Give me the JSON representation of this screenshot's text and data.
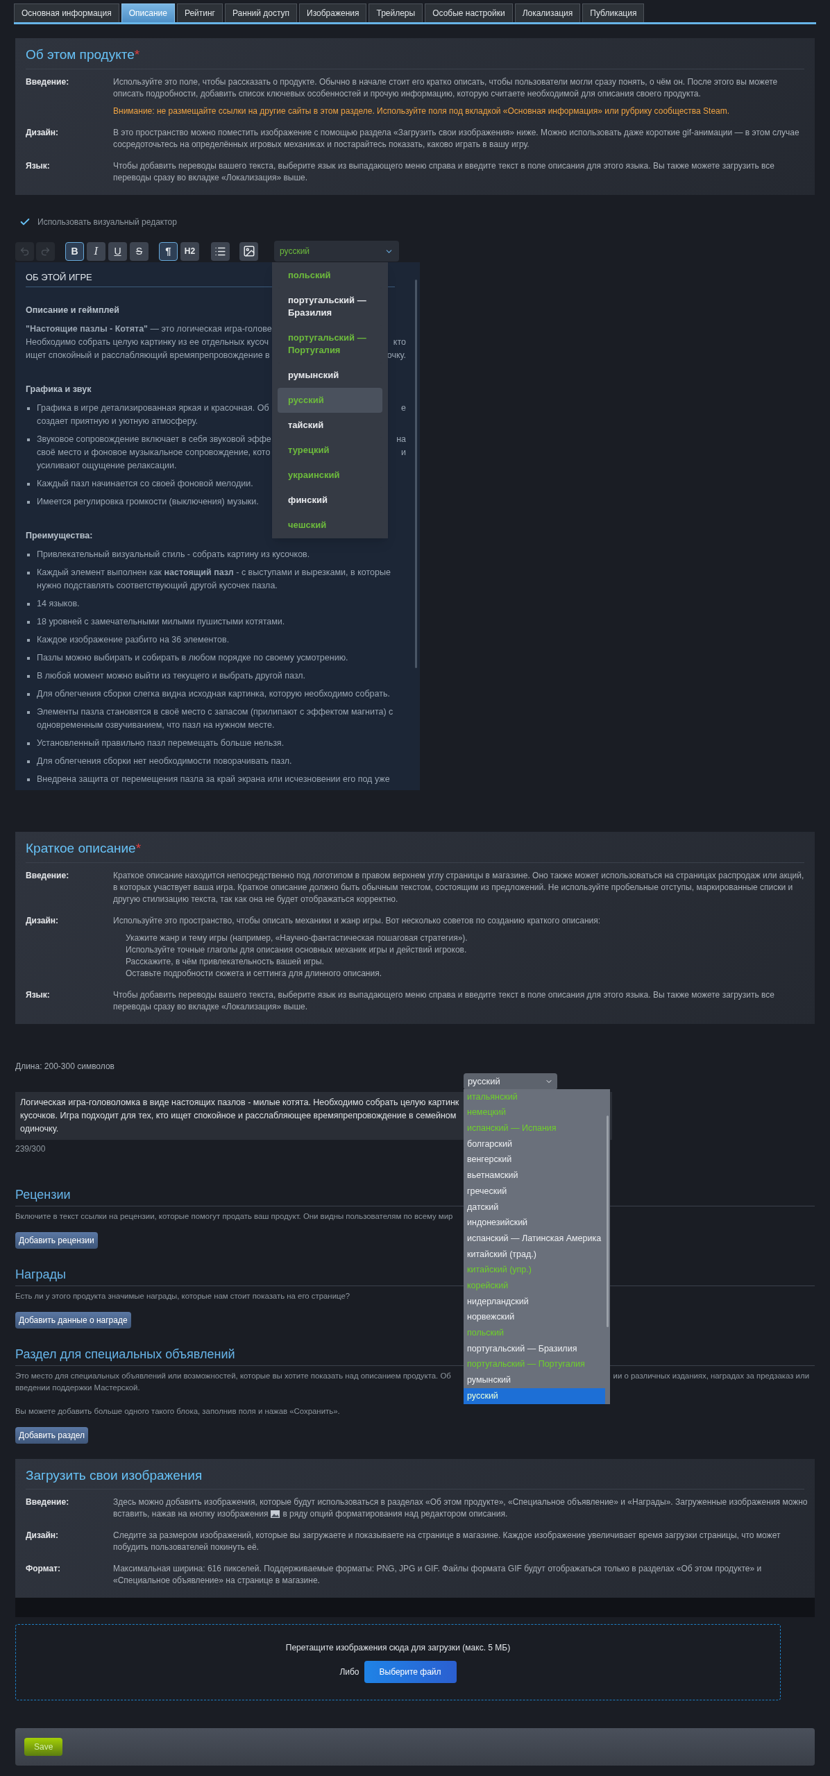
{
  "tabs": [
    {
      "label": "Основная информация",
      "selected": false
    },
    {
      "label": "Описание",
      "selected": true
    },
    {
      "label": "Рейтинг",
      "selected": false
    },
    {
      "label": "Ранний доступ",
      "selected": false
    },
    {
      "label": "Изображения",
      "selected": false
    },
    {
      "label": "Трейлеры",
      "selected": false
    },
    {
      "label": "Особые настройки",
      "selected": false
    },
    {
      "label": "Локализация",
      "selected": false
    },
    {
      "label": "Публикация",
      "selected": false
    }
  ],
  "about": {
    "title": "Об этом продукте",
    "required_mark": "*",
    "rows": [
      {
        "label": "Введение:",
        "text": "Используйте это поле, чтобы рассказать о продукте. Обычно в начале стоит его кратко описать, чтобы пользователи могли сразу понять, о чём он. После этого вы можете описать подробности, добавить список ключевых особенностей и прочую информацию, которую считаете необходимой для описания своего продукта.",
        "warning": "Внимание: не размещайте ссылки на другие сайты в этом разделе. Используйте поля под вкладкой «Основная информация» или рубрику сообщества Steam."
      },
      {
        "label": "Дизайн:",
        "text": "В это пространство можно поместить изображение с помощью раздела «Загрузить свои изображения» ниже. Можно использовать даже короткие gif-анимации — в этом случае сосредоточьтесь на определённых игровых механиках и постарайтесь показать, каково играть в вашу игру."
      },
      {
        "label": "Язык:",
        "text": "Чтобы добавить переводы вашего текста, выберите язык из выпадающего меню справа и введите текст в поле описания для этого языка. Вы также можете загрузить все переводы сразу во вкладке «Локализация» выше."
      }
    ]
  },
  "visual_editor": {
    "label": "Использовать визуальный редактор",
    "checked": true
  },
  "toolbar": {
    "history": [
      {
        "kind": "undo",
        "disabled": true
      },
      {
        "kind": "redo",
        "disabled": true
      }
    ],
    "format": [
      {
        "kind": "bold",
        "label": "B",
        "active": true
      },
      {
        "kind": "italic",
        "label": "I",
        "active": false
      },
      {
        "kind": "underline",
        "label": "U",
        "active": false
      },
      {
        "kind": "strike",
        "label": "S",
        "active": false
      }
    ],
    "block": [
      {
        "kind": "paragraph",
        "label": "¶",
        "active": true
      },
      {
        "kind": "heading",
        "label": "H2",
        "active": false
      }
    ]
  },
  "language_select": {
    "value": "русский",
    "translated": true,
    "options": [
      {
        "label": "польский",
        "translated": true,
        "selected": false
      },
      {
        "label": "португальский — Бразилия",
        "translated": false,
        "selected": false
      },
      {
        "label": "португальский — Португалия",
        "translated": true,
        "selected": false
      },
      {
        "label": "румынский",
        "translated": false,
        "selected": false
      },
      {
        "label": "русский",
        "translated": true,
        "selected": true
      },
      {
        "label": "тайский",
        "translated": false,
        "selected": false
      },
      {
        "label": "турецкий",
        "translated": true,
        "selected": false
      },
      {
        "label": "украинский",
        "translated": true,
        "selected": false
      },
      {
        "label": "финский",
        "translated": false,
        "selected": false
      },
      {
        "label": "чешский",
        "translated": true,
        "selected": false
      }
    ]
  },
  "editor": {
    "heading": "ОБ ЭТОЙ ИГРЕ",
    "blocks": [
      {
        "kind": "subheading",
        "text": "Описание и геймплей"
      },
      {
        "kind": "paragraph",
        "lines": [
          {
            "left": "**\"Настоящие пазлы - Котята\"** — это логическая игра-голове"
          },
          {
            "left": "Необходимо собрать целую картинку из ее отдельных кусоч",
            "right": "кто"
          },
          {
            "left": "ищет спокойный и расслабляющий времяпрепровождение в",
            "right": "очку."
          }
        ]
      },
      {
        "kind": "subheading",
        "text": "Графика и звук"
      },
      {
        "kind": "bullets",
        "items": [
          {
            "lines": [
              {
                "left": "Графика в игре детализированная яркая и красочная. Об",
                "right": "е"
              },
              {
                "left": "создает приятную и уютную атмосферу."
              }
            ]
          },
          {
            "lines": [
              {
                "left": "Звуковое сопровождение включает в себя звуковой эффе",
                "right": "на"
              },
              {
                "left": "своё место и фоновое музыкальное сопровождение, кото",
                "right": "и"
              },
              {
                "left": "усиливают ощущение релаксации."
              }
            ]
          },
          {
            "text": "Каждый пазл начинается со своей фоновой мелодии."
          },
          {
            "text": "Имеется регулировка громкости (выключения) музыки."
          }
        ]
      },
      {
        "kind": "subheading",
        "text": "Преимущества:"
      },
      {
        "kind": "bullets",
        "items": [
          {
            "text": "Привлекательный визуальный стиль - собрать картину из кусочков."
          },
          {
            "text": "Каждый элемент выполнен как **настоящий пазл** - с выступами и вырезками, в которые нужно подставлять соответствующий другой кусочек пазла."
          },
          {
            "text": "14 языков."
          },
          {
            "text": "18 уровней с замечательными милыми пушистыми котятами."
          },
          {
            "text": "Каждое изображение разбито на 36 элементов."
          },
          {
            "text": "Пазлы можно выбирать и собирать в любом порядке по своему усмотрению."
          },
          {
            "text": "В любой момент можно выйти из текущего и выбрать другой пазл."
          },
          {
            "text": "Для облегчения сборки слегка видна исходная картинка, которую необходимо собрать."
          },
          {
            "text": "Элементы пазла становятся в своё место с запасом (прилипают с эффектом магнита) с одновременным озвучиванием, что пазл на нужном месте."
          },
          {
            "text": "Установленный правильно пазл перемещать больше нельзя."
          },
          {
            "text": "Для облегчения сборки нет необходимости поворачивать пазл."
          },
          {
            "lines": [
              {
                "left": "Внедрена защита от перемещения пазла за край экрана или исчезновении его под уже"
              }
            ]
          }
        ]
      }
    ]
  },
  "short_description": {
    "title": "Краткое описание",
    "required_mark": "*",
    "rows": [
      {
        "label": "Введение:",
        "text": "Краткое описание находится непосредственно под логотипом в правом верхнем углу страницы в магазине. Оно также может использоваться на страницах распродаж или акций, в которых участвует ваша игра. Краткое описание должно быть обычным текстом, состоящим из предложений. Не используйте пробельные отступы, маркированные списки и другую стилизацию текста, так как она не будет отображаться корректно."
      },
      {
        "label": "Дизайн:",
        "text": "Используйте это пространство, чтобы описать механики и жанр игры. Вот несколько советов по созданию краткого описания:",
        "tips": [
          "Укажите жанр и тему игры (например, «Научно-фантастическая пошаговая стратегия»).",
          "Используйте точные глаголы для описания основных механик игры и действий игроков.",
          "Расскажите, в чём привлекательность вашей игры.",
          "Оставьте подробности сюжета и сеттинга для длинного описания."
        ]
      },
      {
        "label": "Язык:",
        "text": "Чтобы добавить переводы вашего текста, выберите язык из выпадающего меню справа и введите текст в поле описания для этого языка. Вы также можете загрузить все переводы сразу во вкладке «Локализация» выше."
      }
    ]
  },
  "length_hint": "Длина: 200-300 символов",
  "short_language_select": {
    "value": "русский",
    "options": [
      {
        "label": "итальянский",
        "translated": true,
        "selected": false
      },
      {
        "label": "немецкий",
        "translated": true,
        "selected": false
      },
      {
        "label": "испанский — Испания",
        "translated": true,
        "selected": false
      },
      {
        "label": "болгарский",
        "translated": false,
        "selected": false
      },
      {
        "label": "венгерский",
        "translated": false,
        "selected": false
      },
      {
        "label": "вьетнамский",
        "translated": false,
        "selected": false
      },
      {
        "label": "греческий",
        "translated": false,
        "selected": false
      },
      {
        "label": "датский",
        "translated": false,
        "selected": false
      },
      {
        "label": "индонезийский",
        "translated": false,
        "selected": false
      },
      {
        "label": "испанский — Латинская Америка",
        "translated": false,
        "selected": false
      },
      {
        "label": "китайский (трад.)",
        "translated": false,
        "selected": false
      },
      {
        "label": "китайский (упр.)",
        "translated": true,
        "selected": false
      },
      {
        "label": "корейский",
        "translated": true,
        "selected": false
      },
      {
        "label": "нидерландский",
        "translated": false,
        "selected": false
      },
      {
        "label": "норвежский",
        "translated": false,
        "selected": false
      },
      {
        "label": "польский",
        "translated": true,
        "selected": false
      },
      {
        "label": "португальский — Бразилия",
        "translated": false,
        "selected": false
      },
      {
        "label": "португальский — Португалия",
        "translated": true,
        "selected": false
      },
      {
        "label": "румынский",
        "translated": false,
        "selected": false
      },
      {
        "label": "русский",
        "translated": true,
        "selected": true
      }
    ]
  },
  "short_text": {
    "lines": [
      "Логическая игра-головоломка в виде настоящих пазлов - милые котята. Необходимо собрать целую картинк",
      "кусочков. Игра подходит для тех, кто ищет спокойное и расслабляющее времяпрепровождение в семейном",
      "одиночку."
    ]
  },
  "counter": "239/300",
  "sections": [
    {
      "title": "Рецензии",
      "paragraphs": [
        {
          "lines": [
            {
              "left": "Включите в текст ссылки на рецензии, которые помогут продать ваш продукт. Они видны пользователям по всему мир"
            }
          ]
        }
      ],
      "button": "Добавить рецензии"
    },
    {
      "title": "Награды",
      "paragraphs": [
        {
          "lines": [
            {
              "left": "Есть ли у этого продукта значимые награды, которые нам стоит показать на его странице?"
            }
          ]
        }
      ],
      "button": "Добавить данные о награде"
    },
    {
      "title": "Раздел для специальных объявлений",
      "paragraphs": [
        {
          "lines": [
            {
              "left": "Это место для специальных объявлений или возможностей, которые вы хотите показать над описанием продукта. Об",
              "right": "ии о различных изданиях, наградах за предзаказ или"
            },
            {
              "left": "введении поддержки Мастерской."
            }
          ]
        },
        {
          "lines": [
            {
              "left": "Вы можете добавить больше одного такого блока, заполнив поля и нажав «Сохранить»."
            }
          ]
        }
      ],
      "button": "Добавить раздел"
    }
  ],
  "images": {
    "title": "Загрузить свои изображения",
    "rows": [
      {
        "label": "Введение:",
        "text": "Здесь можно добавить изображения, которые будут использоваться в разделах «Об этом продукте», «Специальное объявление» и «Награды». Загруженные изображения можно",
        "text_mid": "вставить, нажав на кнопку изображения",
        "text_after": "в ряду опций форматирования над редактором описания."
      },
      {
        "label": "Дизайн:",
        "text": "Следите за размером изображений, которые вы загружаете и показываете на странице в магазине. Каждое изображение увеличивает время загрузки страницы, что может побудить пользователей покинуть её."
      },
      {
        "label": "Формат:",
        "text": "Максимальная ширина: 616 пикселей. Поддерживаемые форматы: PNG, JPG и GIF. Файлы формата GIF будут отображаться только в разделах «Об этом продукте» и «Специальное объявление» на странице в магазине."
      }
    ]
  },
  "upload": {
    "hint": "Перетащите изображения сюда для загрузки (макс. 5 МБ)",
    "or": "Либо",
    "button": "Выберите файл"
  },
  "save": "Save"
}
